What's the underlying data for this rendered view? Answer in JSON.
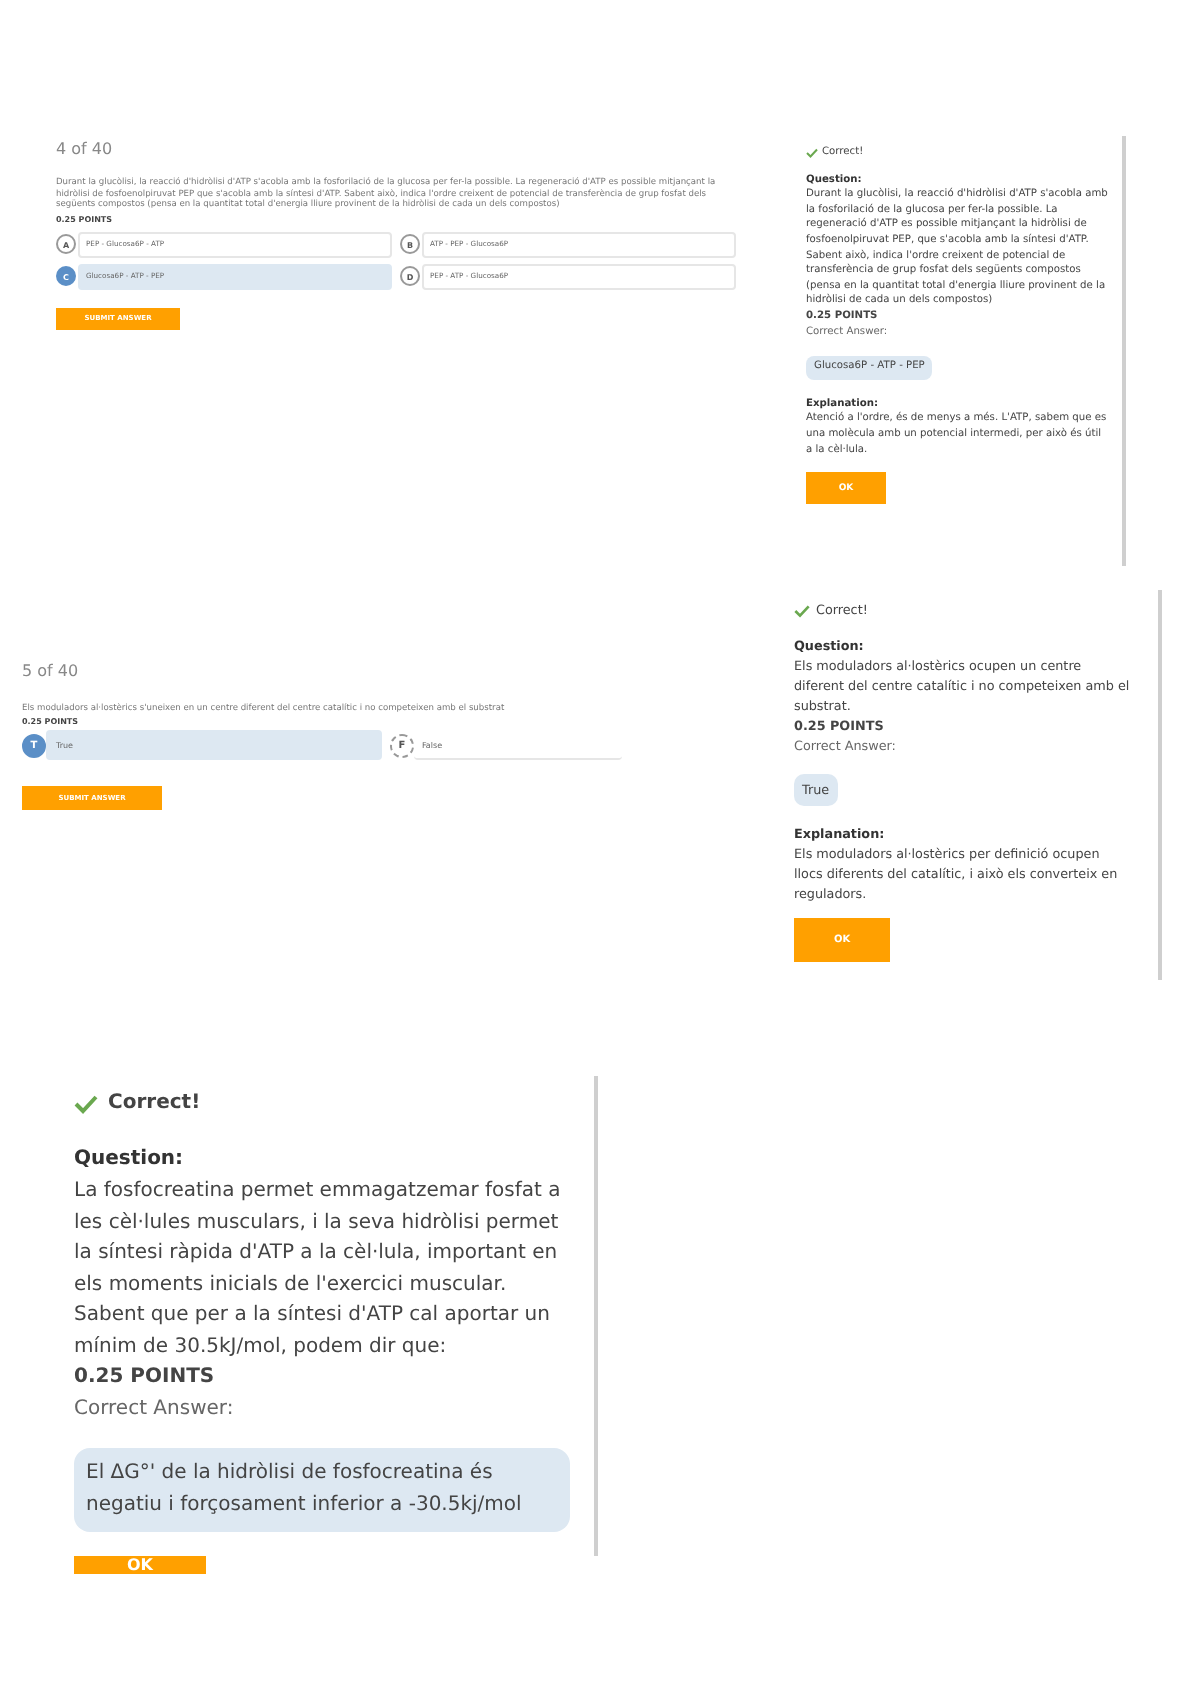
{
  "sections": [
    {
      "quiz": {
        "kind": "multiple_choice",
        "counter": "4 of 40",
        "question": "Durant la glucòlisi, la reacció d'hidròlisi d'ATP s'acobla amb la fosforilació de la glucosa per fer-la possible. La regeneració d'ATP es possible mitjançant la hidròlisi de fosfoenolpiruvat PEP que s'acobla amb la síntesi d'ATP. Sabent això, indica l'ordre creixent de potencial de transferència de grup fosfat dels següents compostos (pensa en la quantitat total d'energia lliure provinent de la hidròlisi de cada un dels compostos)",
        "points": "0.25 POINTS",
        "options": [
          {
            "key": "A",
            "label": "PEP - Glucosa6P - ATP",
            "selected": false
          },
          {
            "key": "B",
            "label": "ATP - PEP - Glucosa6P",
            "selected": false
          },
          {
            "key": "C",
            "label": "Glucosa6P - ATP - PEP",
            "selected": true
          },
          {
            "key": "D",
            "label": "PEP - ATP - Glucosa6P",
            "selected": false
          }
        ],
        "submit": "SUBMIT ANSWER"
      },
      "feedback": {
        "status": "Correct!",
        "question_label": "Question:",
        "question": "Durant la glucòlisi, la reacció d'hidròlisi d'ATP s'acobla amb la fosforilació de la glucosa per fer-la possible. La regeneració d'ATP es possible mitjançant la hidròlisi de fosfoenolpiruvat PEP, que s'acobla amb la síntesi d'ATP. Sabent això, indica l'ordre creixent de potencial de transferència de grup fosfat dels següents compostos (pensa en la quantitat total d'energia lliure provinent de la hidròlisi de cada un dels compostos)",
        "points": "0.25 POINTS",
        "answer_label": "Correct Answer:",
        "answer": "Glucosa6P - ATP - PEP",
        "explanation_label": "Explanation:",
        "explanation": "Atenció a l'ordre, és de menys a més. L'ATP, sabem que es una molècula amb un potencial intermedi, per això és útil a la cèl·lula.",
        "button": "OK"
      }
    },
    {
      "quiz": {
        "kind": "true_false",
        "counter": "5 of 40",
        "question": "Els moduladors al·lostèrics s'uneixen en un centre diferent del centre catalític i no competeixen amb el substrat",
        "points": "0.25 POINTS",
        "options": [
          {
            "key": "T",
            "label": "True",
            "selected": true
          },
          {
            "key": "F",
            "label": "False",
            "selected": false
          }
        ],
        "submit": "SUBMIT ANSWER"
      },
      "feedback": {
        "status": "Correct!",
        "question_label": "Question:",
        "question": "Els moduladors al·lostèrics ocupen un centre diferent del centre catalític i no competeixen amb el substrat.",
        "points": "0.25 POINTS",
        "answer_label": "Correct Answer:",
        "answer": "True",
        "explanation_label": "Explanation:",
        "explanation": "Els moduladors al·lostèrics per definició ocupen llocs diferents del catalític, i això els converteix en reguladors.",
        "button": "OK"
      }
    },
    {
      "feedback": {
        "status": "Correct!",
        "question_label": "Question:",
        "question": "La fosfocreatina permet emmagatzemar fosfat a les cèl·lules musculars, i la seva hidròlisi permet la síntesi ràpida d'ATP a la cèl·lula, important en els moments inicials de l'exercici muscular. Sabent que per a la síntesi d'ATP cal aportar un mínim de 30.5kJ/mol, podem dir que:",
        "points": "0.25 POINTS",
        "answer_label": "Correct Answer:",
        "answer": "El ΔG°' de la hidròlisi de fosfocreatina és negatiu i forçosament inferior a -30.5kj/mol",
        "button": "OK"
      }
    }
  ]
}
